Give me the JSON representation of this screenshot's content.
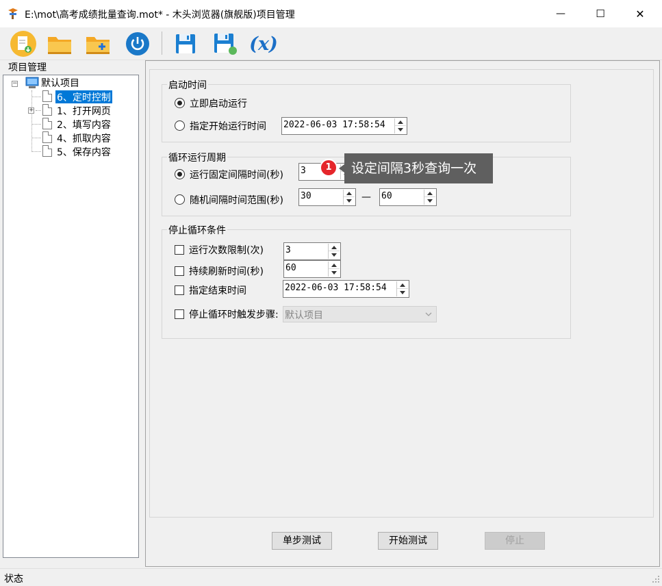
{
  "window": {
    "title": "E:\\mot\\高考成绩批量查询.mot* - 木头浏览器(旗舰版)项目管理",
    "min": "—",
    "max": "☐",
    "close": "✕"
  },
  "toolbar": {
    "items": [
      {
        "name": "new-doc-icon"
      },
      {
        "name": "open-folder-icon"
      },
      {
        "name": "add-folder-icon"
      },
      {
        "name": "power-icon"
      },
      {
        "name": "save-icon"
      },
      {
        "name": "save-as-icon"
      },
      {
        "name": "variable-icon",
        "label": "(x)"
      }
    ]
  },
  "project_panel": {
    "title": "项目管理",
    "root": "默认项目",
    "items": [
      "6、定时控制",
      "1、打开网页",
      "2、填写内容",
      "4、抓取内容",
      "5、保存内容"
    ]
  },
  "start_time": {
    "title": "启动时间",
    "opt_immediate": "立即启动运行",
    "opt_scheduled": "指定开始运行时间",
    "scheduled_value": "2022-06-03 17:58:54"
  },
  "loop_period": {
    "title": "循环运行周期",
    "opt_fixed": "运行固定间隔时间(秒)",
    "fixed_value": "3",
    "opt_random": "随机间隔时间范围(秒)",
    "random_min": "30",
    "dash": "—",
    "random_max": "60"
  },
  "stop_conditions": {
    "title": "停止循环条件",
    "count_label": "运行次数限制(次)",
    "count_value": "3",
    "refresh_label": "持续刷新时间(秒)",
    "refresh_value": "60",
    "end_label": "指定结束时间",
    "end_value": "2022-06-03 17:58:54",
    "trigger_label": "停止循环时触发步骤:",
    "trigger_value": "默认项目"
  },
  "buttons": {
    "step_test": "单步测试",
    "start_test": "开始测试",
    "stop": "停止"
  },
  "annotation": {
    "number": "1",
    "text": "设定间隔3秒查询一次"
  },
  "statusbar": {
    "text": "状态"
  }
}
